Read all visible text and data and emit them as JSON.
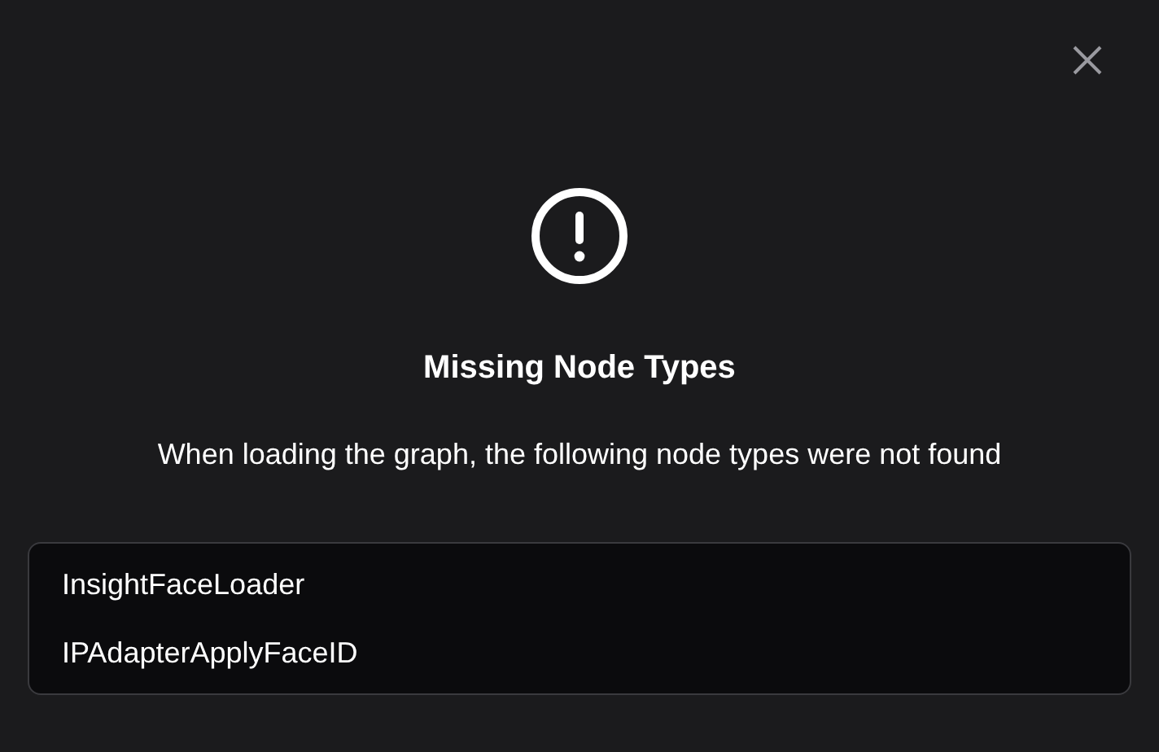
{
  "dialog": {
    "title": "Missing Node Types",
    "message": "When loading the graph, the following node types were not found"
  },
  "missing_nodes": [
    {
      "name": "InsightFaceLoader"
    },
    {
      "name": "IPAdapterApplyFaceID"
    }
  ]
}
